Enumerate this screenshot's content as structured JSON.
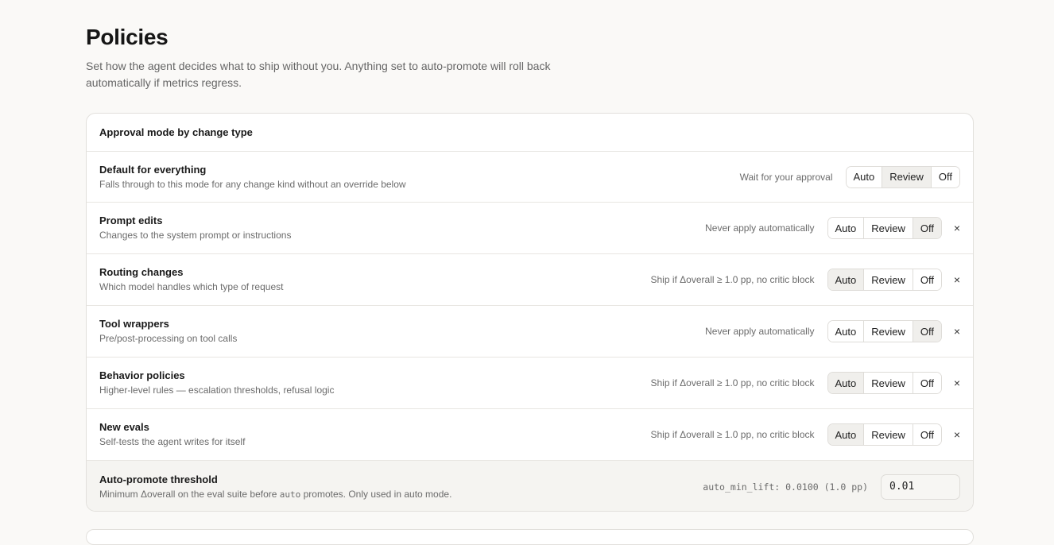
{
  "page": {
    "title": "Policies",
    "subtitle": "Set how the agent decides what to ship without you. Anything set to auto-promote will roll back automatically if metrics regress."
  },
  "card": {
    "header": "Approval mode by change type",
    "options": [
      "Auto",
      "Review",
      "Off"
    ],
    "remove_icon": "×",
    "rows": [
      {
        "title": "Default for everything",
        "desc": "Falls through to this mode for any change kind without an override below",
        "status": "Wait for your approval",
        "selected": "Review",
        "removable": false
      },
      {
        "title": "Prompt edits",
        "desc": "Changes to the system prompt or instructions",
        "status": "Never apply automatically",
        "selected": "Off",
        "removable": true
      },
      {
        "title": "Routing changes",
        "desc": "Which model handles which type of request",
        "status": "Ship if Δoverall ≥ 1.0 pp, no critic block",
        "selected": "Auto",
        "removable": true
      },
      {
        "title": "Tool wrappers",
        "desc": "Pre/post-processing on tool calls",
        "status": "Never apply automatically",
        "selected": "Off",
        "removable": true
      },
      {
        "title": "Behavior policies",
        "desc": "Higher-level rules — escalation thresholds, refusal logic",
        "status": "Ship if Δoverall ≥ 1.0 pp, no critic block",
        "selected": "Auto",
        "removable": true
      },
      {
        "title": "New evals",
        "desc": "Self-tests the agent writes for itself",
        "status": "Ship if Δoverall ≥ 1.0 pp, no critic block",
        "selected": "Auto",
        "removable": true
      }
    ],
    "threshold": {
      "title": "Auto-promote threshold",
      "desc_before": "Minimum Δoverall on the eval suite before ",
      "desc_code": "auto",
      "desc_after": " promotes. Only used in auto mode.",
      "readout": "auto_min_lift: 0.0100 (1.0 pp)",
      "value": "0.01"
    }
  }
}
